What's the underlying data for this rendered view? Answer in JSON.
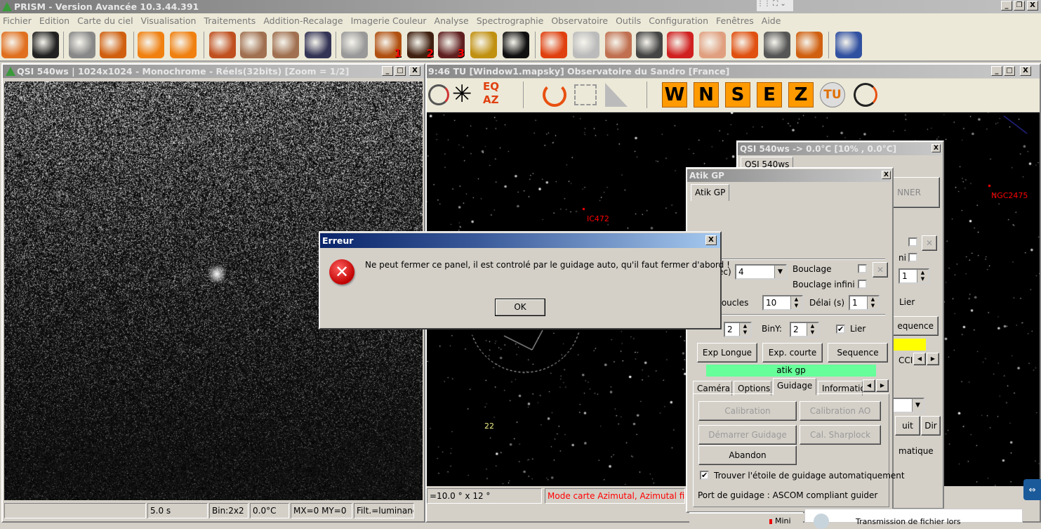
{
  "app": {
    "title": "PRISM - Version Avancée  10.3.44.391"
  },
  "menu": [
    "Fichier",
    "Edition",
    "Carte du ciel",
    "Visualisation",
    "Traitements",
    "Addition-Recalage",
    "Imagerie Couleur",
    "Analyse",
    "Spectrographie",
    "Observatoire",
    "Outils",
    "Configuration",
    "Fenêtres",
    "Aide"
  ],
  "toolbar_icons": [
    "open-icon",
    "save-icon",
    "image-info-icon",
    "info-icon",
    "undo-icon",
    "redo-icon",
    "contrast-icon",
    "zoom-out-icon",
    "zoom-in-icon",
    "view-icon",
    "mount-gear-icon",
    "camera-1-icon",
    "camera-2-icon",
    "camera-3-icon",
    "focuser-icon",
    "telescope-icon",
    "drop-icon",
    "moon-icon",
    "wrench-icon",
    "calibration-icon",
    "refresh-icon",
    "curve-icon",
    "bars-icon",
    "frame-icon",
    "profile-icon",
    "robot-icon"
  ],
  "toolbar_badges": {
    "camera1": "1",
    "camera2": "2",
    "camera3": "3"
  },
  "image_window": {
    "title": "QSI 540ws | 1024x1024 - Monochrome - Réels(32bits)  [Zoom = 1/2]",
    "status": [
      "",
      "5.0 s",
      "Bin:2x2",
      "0.0°C",
      "MX=0 MY=0",
      "Filt.=luminanc"
    ]
  },
  "sky_window": {
    "title": "9:46 TU [Window1.mapsky]  Observatoire du Sandro [France]",
    "cardinal_buttons": [
      "W",
      "N",
      "S",
      "E",
      "Z"
    ],
    "tu_label": "TU",
    "eq_label": "EQ",
    "az_label": "AZ",
    "labels": {
      "ic472": "IC472",
      "ngc2475": "NGC2475",
      "star22": "22"
    },
    "status_fov": "=10.0 ° x 12 °",
    "status_mode": "Mode carte Azimutal, Azimutal fixe, I",
    "status_color": "#ff0000"
  },
  "qsi_panel": {
    "title": "QSI 540ws  -> 0.0°C  [10% , 0.0°C]",
    "tab": "QSI 540ws",
    "partial": {
      "button": "NNER",
      "ni": "ni",
      "spin": "1",
      "lier": "Lier",
      "sequence": "equence",
      "ccd": "CCI",
      "uit": "uit",
      "dir": "Dir",
      "matique": "matique"
    }
  },
  "atik_panel": {
    "title": "Atik GP",
    "tab": "Atik GP",
    "exposure_label_fragment": "ec)",
    "exposure_value": "4",
    "bouclage": "Bouclage",
    "bouclage_infini": "Bouclage infini",
    "boucles_label": "e boucles",
    "boucles_value": "10",
    "delai_label": "Délai (s)",
    "delai_value": "1",
    "binx_value": "2",
    "biny_label": "BinY:",
    "biny_value": "2",
    "lier": "Lier",
    "buttons": [
      "Exp Longue",
      "Exp. courte",
      "Sequence"
    ],
    "camera_name": "atik gp",
    "camera_name_color": "#66ff99",
    "subtabs": [
      "Caméra",
      "Options",
      "Guidage",
      "Information"
    ],
    "active_subtab": "Guidage",
    "guide_buttons": {
      "calibration": "Calibration",
      "calibration_ao": "Calibration AO",
      "start": "Démarrer Guidage",
      "sharplock": "Cal. Sharplock",
      "abort": "Abandon"
    },
    "auto_find": "Trouver l'étoile de guidage automatiquement",
    "auto_find_checked": true,
    "port": "Port de guidage : ASCOM compliant guider"
  },
  "error_dialog": {
    "title": "Erreur",
    "message": "Ne peut fermer ce panel, il est controlé par le guidage auto, qu'il faut fermer d'abord !",
    "ok": "OK"
  },
  "taskbar": {
    "mini": "Mini",
    "transfer": "Transmission de fichier lors"
  }
}
